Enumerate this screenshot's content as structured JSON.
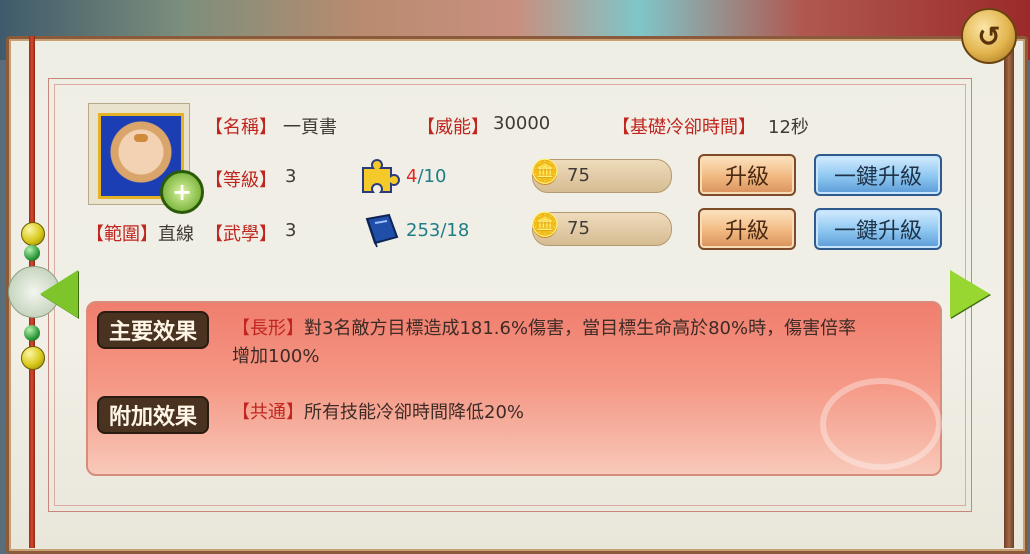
{
  "skill": {
    "name_label": "【名稱】",
    "name_value": "一頁書",
    "power_label": "【威能】",
    "power_value": "30000",
    "cooldown_label": "【基礎冷卻時間】",
    "cooldown_value": "12秒",
    "level_label": "【等級】",
    "level_value": "3",
    "martial_label": "【武學】",
    "martial_value": "3",
    "range_label": "【範圍】",
    "range_value": "直線"
  },
  "upgrade": {
    "row1": {
      "fragment_current": "4",
      "fragment_sep_total": "/10",
      "coins": "75",
      "upgrade_label": "升級",
      "one_click_label": "一鍵升級"
    },
    "row2": {
      "book_value": "253/18",
      "coins": "75",
      "upgrade_label": "升級",
      "one_click_label": "一鍵升級"
    }
  },
  "effects": {
    "main_tag": "主要效果",
    "main_key": "【長形】",
    "main_line1": "對3名敵方目標造成181.6%傷害，當目標生命高於80%時，傷害倍率",
    "main_line2": "增加100%",
    "extra_tag": "附加效果",
    "extra_key": "【共通】",
    "extra_text": "所有技能冷卻時間降低20%"
  },
  "icons": {
    "back": "back-arrow-icon",
    "prev": "left-arrow-icon",
    "next": "right-arrow-icon",
    "zoom": "zoom-in-icon",
    "puzzle": "puzzle-fragment-icon",
    "book": "book-icon",
    "coins": "coin-stack-icon"
  }
}
